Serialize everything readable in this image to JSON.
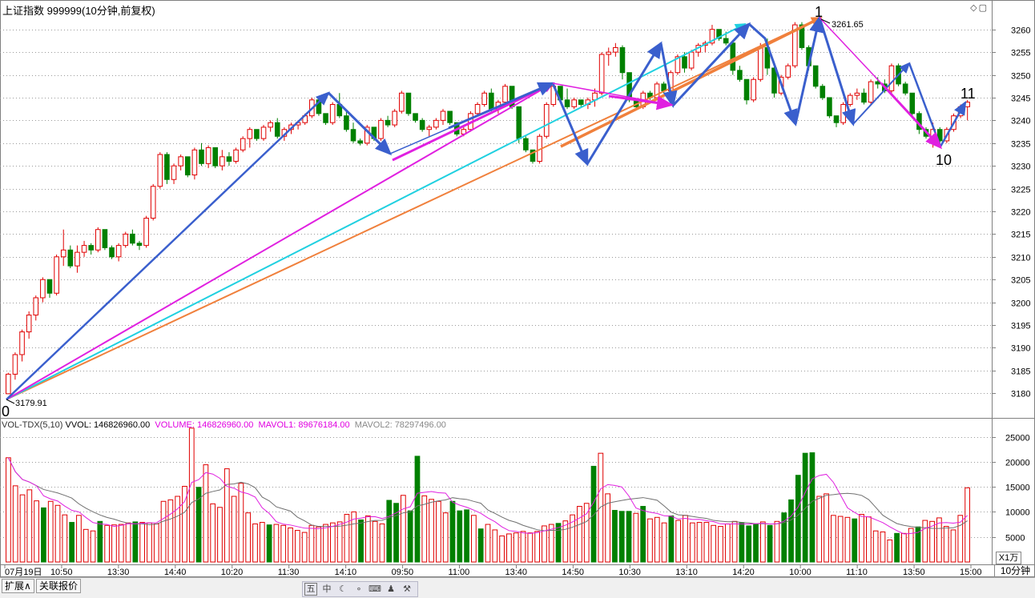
{
  "header": {
    "title": "上证指数 999999(10分钟,前复权)"
  },
  "window_controls": "◇▢",
  "chart_data": [
    {
      "type": "candlestick",
      "ylim": [
        3176,
        3264
      ],
      "y_ticks": [
        3180,
        3185,
        3190,
        3195,
        3200,
        3205,
        3210,
        3215,
        3220,
        3225,
        3230,
        3235,
        3240,
        3245,
        3250,
        3255,
        3260
      ],
      "up_color": "#e00000",
      "down_color": "#008000",
      "candles": [
        [
          3179.9,
          3184.5,
          3179.9,
          3184.2
        ],
        [
          3184.2,
          3189,
          3183,
          3188.5
        ],
        [
          3188.5,
          3194,
          3187,
          3193.5
        ],
        [
          3193.5,
          3198,
          3192,
          3197.2
        ],
        [
          3197.2,
          3201.5,
          3196,
          3201
        ],
        [
          3201,
          3205.5,
          3200,
          3205
        ],
        [
          3205,
          3203,
          3201,
          3202
        ],
        [
          3202,
          3210.5,
          3201.5,
          3210
        ],
        [
          3210,
          3216,
          3208,
          3211.5
        ],
        [
          3211.5,
          3212.5,
          3207.5,
          3208
        ],
        [
          3208,
          3212.5,
          3206.5,
          3211
        ],
        [
          3211,
          3213.5,
          3210,
          3212.5
        ],
        [
          3212.5,
          3213,
          3210.5,
          3211.5
        ],
        [
          3211.5,
          3216.5,
          3211,
          3216
        ],
        [
          3216,
          3215,
          3211.5,
          3212
        ],
        [
          3212,
          3212.5,
          3209.5,
          3210
        ],
        [
          3210,
          3213,
          3209,
          3212.5
        ],
        [
          3212.5,
          3215.5,
          3212,
          3215
        ],
        [
          3215,
          3216,
          3212.5,
          3213
        ],
        [
          3213,
          3213.5,
          3211.5,
          3212.5
        ],
        [
          3212.5,
          3219,
          3212,
          3218.5
        ],
        [
          3218.5,
          3226,
          3218,
          3225.5
        ],
        [
          3225.5,
          3233,
          3225,
          3232.5
        ],
        [
          3232.5,
          3233,
          3226,
          3227
        ],
        [
          3227,
          3230.5,
          3226,
          3230
        ],
        [
          3230,
          3232.5,
          3229,
          3232
        ],
        [
          3232,
          3231.5,
          3227.5,
          3228
        ],
        [
          3228,
          3234,
          3227,
          3233.5
        ],
        [
          3233.5,
          3235,
          3230,
          3230.5
        ],
        [
          3230.5,
          3234.5,
          3229.5,
          3234
        ],
        [
          3234,
          3233.5,
          3229.5,
          3230
        ],
        [
          3230,
          3233.5,
          3229,
          3232
        ],
        [
          3232,
          3233,
          3230,
          3231
        ],
        [
          3231,
          3234,
          3230.5,
          3233.5
        ],
        [
          3233.5,
          3236.5,
          3233,
          3236
        ],
        [
          3236,
          3238.5,
          3234,
          3238
        ],
        [
          3238,
          3237.5,
          3235.5,
          3236
        ],
        [
          3236,
          3239,
          3235.5,
          3238.5
        ],
        [
          3238.5,
          3240,
          3237.5,
          3239.5
        ],
        [
          3239.5,
          3240.5,
          3236,
          3236.5
        ],
        [
          3236.5,
          3238.5,
          3235.5,
          3238
        ],
        [
          3238,
          3239.5,
          3237,
          3239
        ],
        [
          3239,
          3240,
          3238,
          3239.5
        ],
        [
          3239.5,
          3241.5,
          3239,
          3241
        ],
        [
          3241,
          3245,
          3240.5,
          3244.5
        ],
        [
          3244.5,
          3243.5,
          3241,
          3241.5
        ],
        [
          3241.5,
          3241.5,
          3239,
          3239.5
        ],
        [
          3239.5,
          3244,
          3239,
          3243.5
        ],
        [
          3243.5,
          3246,
          3240.5,
          3241
        ],
        [
          3241,
          3242,
          3237.5,
          3238
        ],
        [
          3238,
          3239.5,
          3235,
          3235.5
        ],
        [
          3235.5,
          3236,
          3234.5,
          3235
        ],
        [
          3235,
          3239,
          3234.5,
          3238.5
        ],
        [
          3238.5,
          3237.5,
          3235.5,
          3236
        ],
        [
          3236,
          3240.5,
          3235.5,
          3240
        ],
        [
          3240,
          3241,
          3238.5,
          3239
        ],
        [
          3239,
          3242.5,
          3238.5,
          3242
        ],
        [
          3242,
          3246.5,
          3241.5,
          3246
        ],
        [
          3246,
          3245.5,
          3241,
          3241.5
        ],
        [
          3241.5,
          3241.5,
          3239.5,
          3240
        ],
        [
          3240,
          3240.5,
          3237.5,
          3238
        ],
        [
          3238,
          3239,
          3236.5,
          3238.5
        ],
        [
          3238.5,
          3240.5,
          3238,
          3240
        ],
        [
          3240,
          3242.5,
          3239,
          3242
        ],
        [
          3242,
          3241.5,
          3239,
          3239.5
        ],
        [
          3239.5,
          3239.5,
          3236.5,
          3237
        ],
        [
          3237,
          3238.5,
          3236.5,
          3238
        ],
        [
          3238,
          3242,
          3237.5,
          3241.5
        ],
        [
          3241.5,
          3244,
          3241,
          3243.5
        ],
        [
          3243.5,
          3246.5,
          3243,
          3246
        ],
        [
          3246,
          3247,
          3242,
          3242.5
        ],
        [
          3242.5,
          3244.5,
          3241.5,
          3244
        ],
        [
          3244,
          3248,
          3243.5,
          3247.5
        ],
        [
          3247.5,
          3247.5,
          3242.5,
          3243
        ],
        [
          3243,
          3240,
          3235,
          3236
        ],
        [
          3236,
          3236.5,
          3233,
          3233.5
        ],
        [
          3233.5,
          3232.5,
          3230.5,
          3231
        ],
        [
          3231,
          3237,
          3230.5,
          3236.5
        ],
        [
          3236.5,
          3244,
          3236,
          3243.5
        ],
        [
          3243.5,
          3248,
          3243,
          3247.5
        ],
        [
          3247.5,
          3247,
          3244,
          3244.5
        ],
        [
          3244.5,
          3247,
          3242.5,
          3243
        ],
        [
          3243,
          3245,
          3242.5,
          3244.5
        ],
        [
          3244.5,
          3244,
          3243,
          3243.5
        ],
        [
          3243.5,
          3245,
          3242.5,
          3244.5
        ],
        [
          3244.5,
          3247,
          3243,
          3246
        ],
        [
          3246,
          3255,
          3245.5,
          3254.5
        ],
        [
          3254.5,
          3256,
          3252,
          3255
        ],
        [
          3255,
          3257,
          3254,
          3256
        ],
        [
          3256,
          3256.5,
          3249,
          3250.5
        ],
        [
          3250.5,
          3250,
          3244,
          3244.5
        ],
        [
          3244.5,
          3244.5,
          3242.5,
          3243
        ],
        [
          3243,
          3246.5,
          3242.5,
          3246
        ],
        [
          3246,
          3246.5,
          3244.5,
          3245
        ],
        [
          3245,
          3248.5,
          3244.5,
          3248
        ],
        [
          3248,
          3248.5,
          3246,
          3246.5
        ],
        [
          3246.5,
          3251,
          3246,
          3250.5
        ],
        [
          3250.5,
          3254.5,
          3250,
          3254
        ],
        [
          3254,
          3255,
          3250.5,
          3251.5
        ],
        [
          3251.5,
          3255.5,
          3251,
          3255
        ],
        [
          3255,
          3257,
          3254,
          3256.5
        ],
        [
          3256.5,
          3257.5,
          3255,
          3257
        ],
        [
          3257,
          3261,
          3256.5,
          3260
        ],
        [
          3260,
          3259.5,
          3257.5,
          3258
        ],
        [
          3258,
          3259.5,
          3256.5,
          3257
        ],
        [
          3257,
          3257.5,
          3250,
          3251
        ],
        [
          3251,
          3252,
          3248.5,
          3249
        ],
        [
          3249,
          3249,
          3243.5,
          3244.5
        ],
        [
          3244.5,
          3249.5,
          3244,
          3249
        ],
        [
          3249,
          3257,
          3248.5,
          3256
        ],
        [
          3256,
          3258,
          3250,
          3251.5
        ],
        [
          3251.5,
          3252,
          3245,
          3246
        ],
        [
          3246,
          3250,
          3245.5,
          3249.5
        ],
        [
          3249.5,
          3252.5,
          3249,
          3252
        ],
        [
          3252,
          3261.6,
          3251.5,
          3261
        ],
        [
          3261,
          3261.6,
          3255.5,
          3256
        ],
        [
          3256,
          3256.5,
          3251,
          3252
        ],
        [
          3252,
          3252,
          3247,
          3247.5
        ],
        [
          3247.5,
          3248,
          3244.5,
          3245
        ],
        [
          3245,
          3245,
          3240.5,
          3241
        ],
        [
          3241,
          3241,
          3238.5,
          3239.5
        ],
        [
          3239.5,
          3244,
          3239,
          3243.5
        ],
        [
          3243.5,
          3246,
          3243,
          3245.5
        ],
        [
          3245.5,
          3247,
          3244.5,
          3246
        ],
        [
          3246,
          3247,
          3243.5,
          3244
        ],
        [
          3244,
          3249,
          3243.5,
          3248.5
        ],
        [
          3248.5,
          3249.5,
          3247,
          3248
        ],
        [
          3248,
          3249,
          3246,
          3246.5
        ],
        [
          3246.5,
          3252.5,
          3246,
          3252
        ],
        [
          3252,
          3252.5,
          3247.5,
          3248
        ],
        [
          3248,
          3248.5,
          3245.5,
          3246
        ],
        [
          3246,
          3246,
          3240.5,
          3241.5
        ],
        [
          3241.5,
          3242,
          3237,
          3238
        ],
        [
          3238,
          3238.5,
          3236,
          3236.5
        ],
        [
          3236.5,
          3239.5,
          3234,
          3238
        ],
        [
          3238,
          3238.5,
          3235,
          3235.5
        ],
        [
          3235.5,
          3238.5,
          3235,
          3238
        ],
        [
          3238,
          3241.5,
          3237.5,
          3241
        ],
        [
          3241,
          3243.5,
          3240.5,
          3243
        ],
        [
          3243,
          3244.5,
          3240,
          3244
        ]
      ]
    },
    {
      "type": "bar",
      "label": "VOL-TDX(5,10)",
      "ylim": [
        0,
        27000
      ],
      "y_ticks": [
        5000,
        10000,
        15000,
        20000,
        25000
      ],
      "unit": "X1万",
      "volumes": [
        20800,
        15200,
        13400,
        14400,
        12200,
        10800,
        12100,
        11300,
        9400,
        7900,
        9300,
        6500,
        6200,
        8100,
        7300,
        7400,
        7500,
        7800,
        8000,
        7900,
        7800,
        7600,
        12100,
        12400,
        13100,
        15100,
        26700,
        14900,
        19400,
        11600,
        10900,
        18600,
        13100,
        15700,
        9800,
        7600,
        7900,
        7400,
        7500,
        7300,
        6800,
        6300,
        5900,
        7300,
        7000,
        7500,
        7800,
        8000,
        9500,
        10000,
        8400,
        9200,
        8100,
        7600,
        12300,
        11700,
        13300,
        10200,
        21100,
        13200,
        12500,
        12100,
        9800,
        12100,
        10200,
        10400,
        9300,
        6600,
        7500,
        6400,
        5200,
        5600,
        5800,
        6100,
        5800,
        6100,
        7200,
        7500,
        7700,
        8200,
        9400,
        11100,
        11700,
        19100,
        21700,
        13600,
        10300,
        10100,
        10100,
        9700,
        11100,
        8600,
        8900,
        7800,
        9200,
        8300,
        9300,
        7800,
        7900,
        7900,
        7300,
        7100,
        7600,
        8100,
        7800,
        7200,
        7500,
        8000,
        7300,
        8100,
        9800,
        12400,
        17300,
        21700,
        21800,
        13100,
        13600,
        9300,
        9100,
        8900,
        8600,
        9500,
        9000,
        6200,
        6000,
        4400,
        5700,
        5700,
        6700,
        7000,
        8300,
        8100,
        8800,
        7100,
        6400,
        9300,
        14800
      ],
      "vol_colors": "rrrrrgrrrgrrrgrrrrgrrrrrrrrgrrrrrrrrrgrrrrrrrrrrrrgrrrggrggrrrrgggrgrrrrrrrrrrgrrrrgrrgggrgrrrgrrrrrrrrrgggrgrgggggrrrrrgrrrrrgrrgrrr"
    }
  ],
  "annotations": {
    "label_0": "0",
    "label_1": "1",
    "label_10": "10",
    "label_11": "11",
    "low_value": "3179.91",
    "high_value": "3261.65"
  },
  "volume_header": {
    "title": "VOL-TDX(5,10)",
    "vvol": "VVOL: 146826960.00",
    "volume": "VOLUME: 146826960.00",
    "mavol1": "MAVOL1: 89676184.00",
    "mavol2": "MAVOL2: 78297496.00"
  },
  "x_axis": {
    "labels": [
      "07月19日",
      "10:50",
      "13:30",
      "14:40",
      "10:20",
      "11:30",
      "14:10",
      "09:50",
      "11:00",
      "13:40",
      "14:50",
      "10:30",
      "13:10",
      "14:20",
      "10:00",
      "11:10",
      "13:50",
      "15:00"
    ]
  },
  "volume_unit": "X1万",
  "period": "10分钟",
  "tabs": {
    "expand": "扩展∧",
    "linked_quotes": "关联报价"
  },
  "toolbar": {
    "icons": [
      "五",
      "中",
      "☾",
      "∘",
      "⌨",
      "♟",
      "⚒"
    ]
  }
}
